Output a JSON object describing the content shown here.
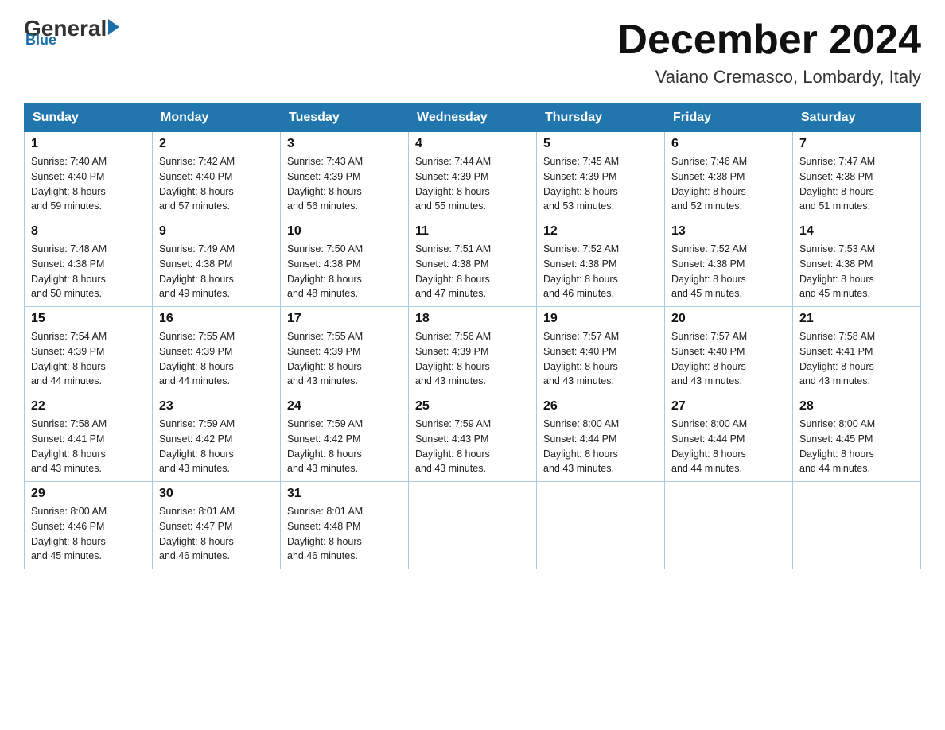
{
  "header": {
    "logo": {
      "general": "General",
      "blue": "Blue"
    },
    "title": "December 2024",
    "subtitle": "Vaiano Cremasco, Lombardy, Italy"
  },
  "days_of_week": [
    "Sunday",
    "Monday",
    "Tuesday",
    "Wednesday",
    "Thursday",
    "Friday",
    "Saturday"
  ],
  "weeks": [
    [
      {
        "day": 1,
        "sunrise": "7:40 AM",
        "sunset": "4:40 PM",
        "daylight": "8 hours and 59 minutes."
      },
      {
        "day": 2,
        "sunrise": "7:42 AM",
        "sunset": "4:40 PM",
        "daylight": "8 hours and 57 minutes."
      },
      {
        "day": 3,
        "sunrise": "7:43 AM",
        "sunset": "4:39 PM",
        "daylight": "8 hours and 56 minutes."
      },
      {
        "day": 4,
        "sunrise": "7:44 AM",
        "sunset": "4:39 PM",
        "daylight": "8 hours and 55 minutes."
      },
      {
        "day": 5,
        "sunrise": "7:45 AM",
        "sunset": "4:39 PM",
        "daylight": "8 hours and 53 minutes."
      },
      {
        "day": 6,
        "sunrise": "7:46 AM",
        "sunset": "4:38 PM",
        "daylight": "8 hours and 52 minutes."
      },
      {
        "day": 7,
        "sunrise": "7:47 AM",
        "sunset": "4:38 PM",
        "daylight": "8 hours and 51 minutes."
      }
    ],
    [
      {
        "day": 8,
        "sunrise": "7:48 AM",
        "sunset": "4:38 PM",
        "daylight": "8 hours and 50 minutes."
      },
      {
        "day": 9,
        "sunrise": "7:49 AM",
        "sunset": "4:38 PM",
        "daylight": "8 hours and 49 minutes."
      },
      {
        "day": 10,
        "sunrise": "7:50 AM",
        "sunset": "4:38 PM",
        "daylight": "8 hours and 48 minutes."
      },
      {
        "day": 11,
        "sunrise": "7:51 AM",
        "sunset": "4:38 PM",
        "daylight": "8 hours and 47 minutes."
      },
      {
        "day": 12,
        "sunrise": "7:52 AM",
        "sunset": "4:38 PM",
        "daylight": "8 hours and 46 minutes."
      },
      {
        "day": 13,
        "sunrise": "7:52 AM",
        "sunset": "4:38 PM",
        "daylight": "8 hours and 45 minutes."
      },
      {
        "day": 14,
        "sunrise": "7:53 AM",
        "sunset": "4:38 PM",
        "daylight": "8 hours and 45 minutes."
      }
    ],
    [
      {
        "day": 15,
        "sunrise": "7:54 AM",
        "sunset": "4:39 PM",
        "daylight": "8 hours and 44 minutes."
      },
      {
        "day": 16,
        "sunrise": "7:55 AM",
        "sunset": "4:39 PM",
        "daylight": "8 hours and 44 minutes."
      },
      {
        "day": 17,
        "sunrise": "7:55 AM",
        "sunset": "4:39 PM",
        "daylight": "8 hours and 43 minutes."
      },
      {
        "day": 18,
        "sunrise": "7:56 AM",
        "sunset": "4:39 PM",
        "daylight": "8 hours and 43 minutes."
      },
      {
        "day": 19,
        "sunrise": "7:57 AM",
        "sunset": "4:40 PM",
        "daylight": "8 hours and 43 minutes."
      },
      {
        "day": 20,
        "sunrise": "7:57 AM",
        "sunset": "4:40 PM",
        "daylight": "8 hours and 43 minutes."
      },
      {
        "day": 21,
        "sunrise": "7:58 AM",
        "sunset": "4:41 PM",
        "daylight": "8 hours and 43 minutes."
      }
    ],
    [
      {
        "day": 22,
        "sunrise": "7:58 AM",
        "sunset": "4:41 PM",
        "daylight": "8 hours and 43 minutes."
      },
      {
        "day": 23,
        "sunrise": "7:59 AM",
        "sunset": "4:42 PM",
        "daylight": "8 hours and 43 minutes."
      },
      {
        "day": 24,
        "sunrise": "7:59 AM",
        "sunset": "4:42 PM",
        "daylight": "8 hours and 43 minutes."
      },
      {
        "day": 25,
        "sunrise": "7:59 AM",
        "sunset": "4:43 PM",
        "daylight": "8 hours and 43 minutes."
      },
      {
        "day": 26,
        "sunrise": "8:00 AM",
        "sunset": "4:44 PM",
        "daylight": "8 hours and 43 minutes."
      },
      {
        "day": 27,
        "sunrise": "8:00 AM",
        "sunset": "4:44 PM",
        "daylight": "8 hours and 44 minutes."
      },
      {
        "day": 28,
        "sunrise": "8:00 AM",
        "sunset": "4:45 PM",
        "daylight": "8 hours and 44 minutes."
      }
    ],
    [
      {
        "day": 29,
        "sunrise": "8:00 AM",
        "sunset": "4:46 PM",
        "daylight": "8 hours and 45 minutes."
      },
      {
        "day": 30,
        "sunrise": "8:01 AM",
        "sunset": "4:47 PM",
        "daylight": "8 hours and 46 minutes."
      },
      {
        "day": 31,
        "sunrise": "8:01 AM",
        "sunset": "4:48 PM",
        "daylight": "8 hours and 46 minutes."
      },
      null,
      null,
      null,
      null
    ]
  ]
}
